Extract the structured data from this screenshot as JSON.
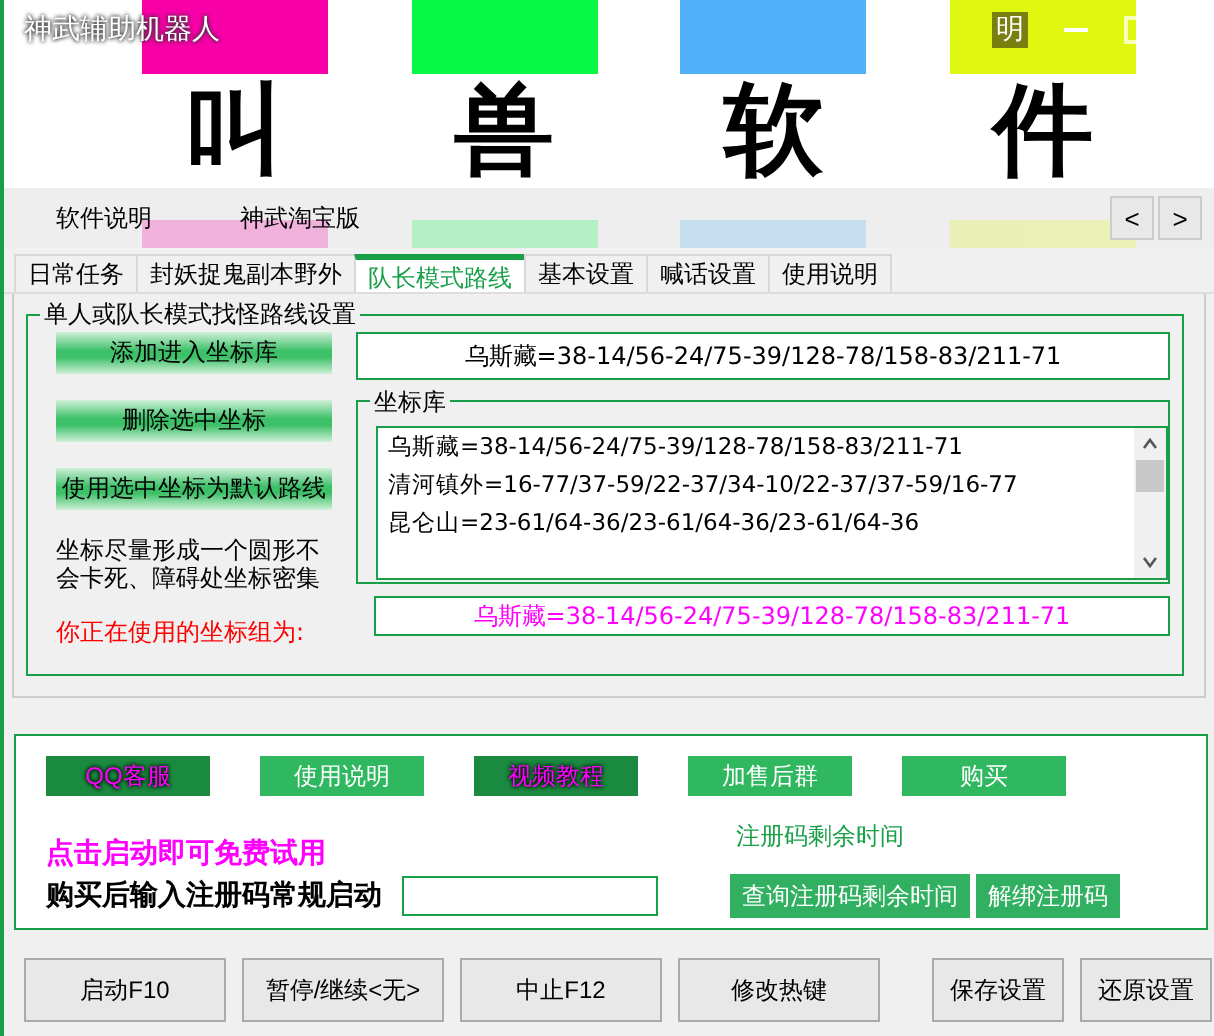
{
  "window": {
    "title": "神武辅助机器人",
    "notice": "明"
  },
  "banner": [
    {
      "char": "叫",
      "color": "#f800a8"
    },
    {
      "char": "兽",
      "color": "#08f848"
    },
    {
      "char": "软",
      "color": "#50b0f8"
    },
    {
      "char": "件",
      "color": "#e0f810"
    }
  ],
  "top_tabs": [
    {
      "label": "软件说明"
    },
    {
      "label": "神武淘宝版"
    }
  ],
  "arrows": [
    "<",
    ">"
  ],
  "tabs": [
    {
      "label": "日常任务",
      "selected": false
    },
    {
      "label": "封妖捉鬼副本野外",
      "selected": false
    },
    {
      "label": "队长模式路线",
      "selected": true
    },
    {
      "label": "基本设置",
      "selected": false
    },
    {
      "label": "喊话设置",
      "selected": false
    },
    {
      "label": "使用说明",
      "selected": false
    }
  ],
  "route_group": {
    "title": "单人或队长模式找怪路线设置",
    "buttons": [
      "添加进入坐标库",
      "删除选中坐标",
      "使用选中坐标为默认路线"
    ],
    "route_value": "乌斯藏=38-14/56-24/75-39/128-78/158-83/211-71",
    "library_title": "坐标库",
    "library_items": [
      "乌斯藏=38-14/56-24/75-39/128-78/158-83/211-71",
      "清河镇外=16-77/37-59/22-37/34-10/22-37/37-59/16-77",
      "昆仑山=23-61/64-36/23-61/64-36/23-61/64-36"
    ],
    "note": "坐标尽量形成一个圆形不会卡死、障碍处坐标密集",
    "current_label": "你正在使用的坐标组为:",
    "current_value": "乌斯藏=38-14/56-24/75-39/128-78/158-83/211-71"
  },
  "links": [
    {
      "label": "QQ客服",
      "highlighted": true
    },
    {
      "label": "使用说明",
      "highlighted": false
    },
    {
      "label": "视频教程",
      "highlighted": true
    },
    {
      "label": "加售后群",
      "highlighted": false
    },
    {
      "label": "购买",
      "highlighted": false
    }
  ],
  "remaining_label": "注册码剩余时间",
  "trial_text": "点击启动即可免费试用",
  "register_label": "购买后输入注册码常规启动",
  "register_buttons": [
    "查询注册码剩余时间",
    "解绑注册码"
  ],
  "bottom_buttons": [
    "启动F10",
    "暂停/继续<无>",
    "中止F12",
    "修改热键",
    "保存设置",
    "还原设置"
  ]
}
